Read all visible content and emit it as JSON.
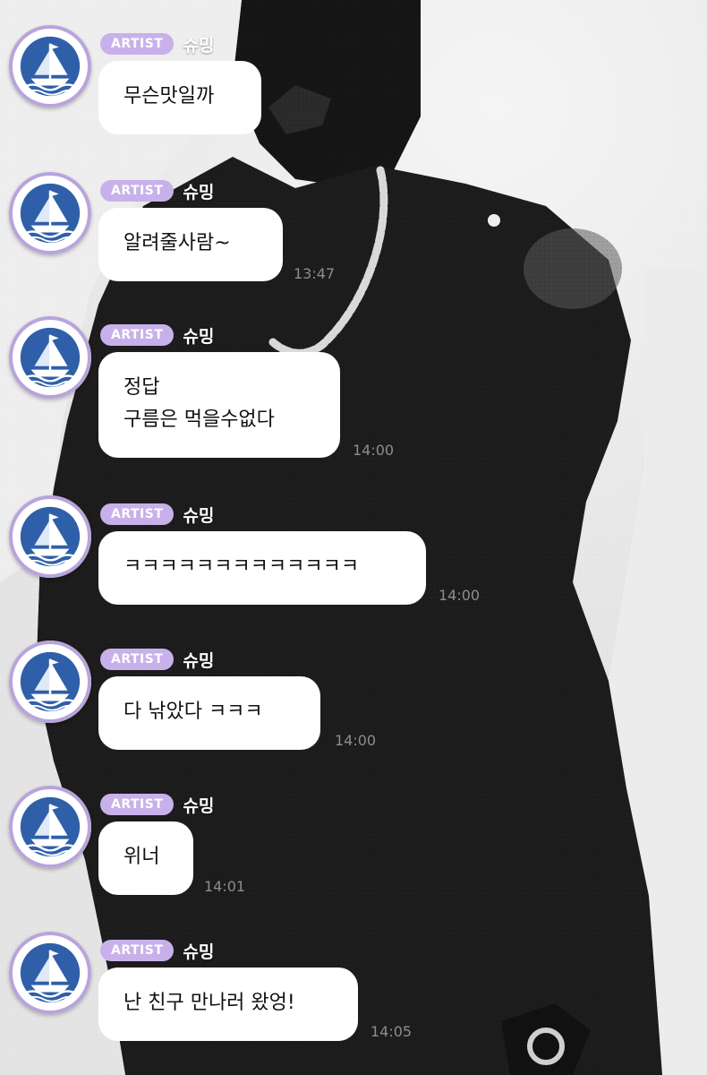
{
  "messages": [
    {
      "badge": "ARTIST",
      "author": "슈밍",
      "text": "무슨맛일까",
      "time": ""
    },
    {
      "badge": "ARTIST",
      "author": "슈밍",
      "text": "알려줄사람~",
      "time": "13:47"
    },
    {
      "badge": "ARTIST",
      "author": "슈밍",
      "text": "정답\n구름은 먹을수없다",
      "time": "14:00"
    },
    {
      "badge": "ARTIST",
      "author": "슈밍",
      "text": "ㅋㅋㅋㅋㅋㅋㅋㅋㅋㅋㅋㅋㅋ",
      "time": "14:00"
    },
    {
      "badge": "ARTIST",
      "author": "슈밍",
      "text": "다 낚았다 ㅋㅋㅋ",
      "time": "14:00"
    },
    {
      "badge": "ARTIST",
      "author": "슈밍",
      "text": "위너",
      "time": "14:01"
    },
    {
      "badge": "ARTIST",
      "author": "슈밍",
      "text": "난 친구 만나러 왔엉!",
      "time": "14:05"
    }
  ],
  "colors": {
    "badge": "#c8b1ea",
    "bubble": "#ffffff",
    "time": "#8d8d8d",
    "avatar_ring": "#b8a4dc",
    "avatar_blue": "#2f5fa8"
  },
  "icons": {
    "avatar": "sailboat-icon"
  }
}
